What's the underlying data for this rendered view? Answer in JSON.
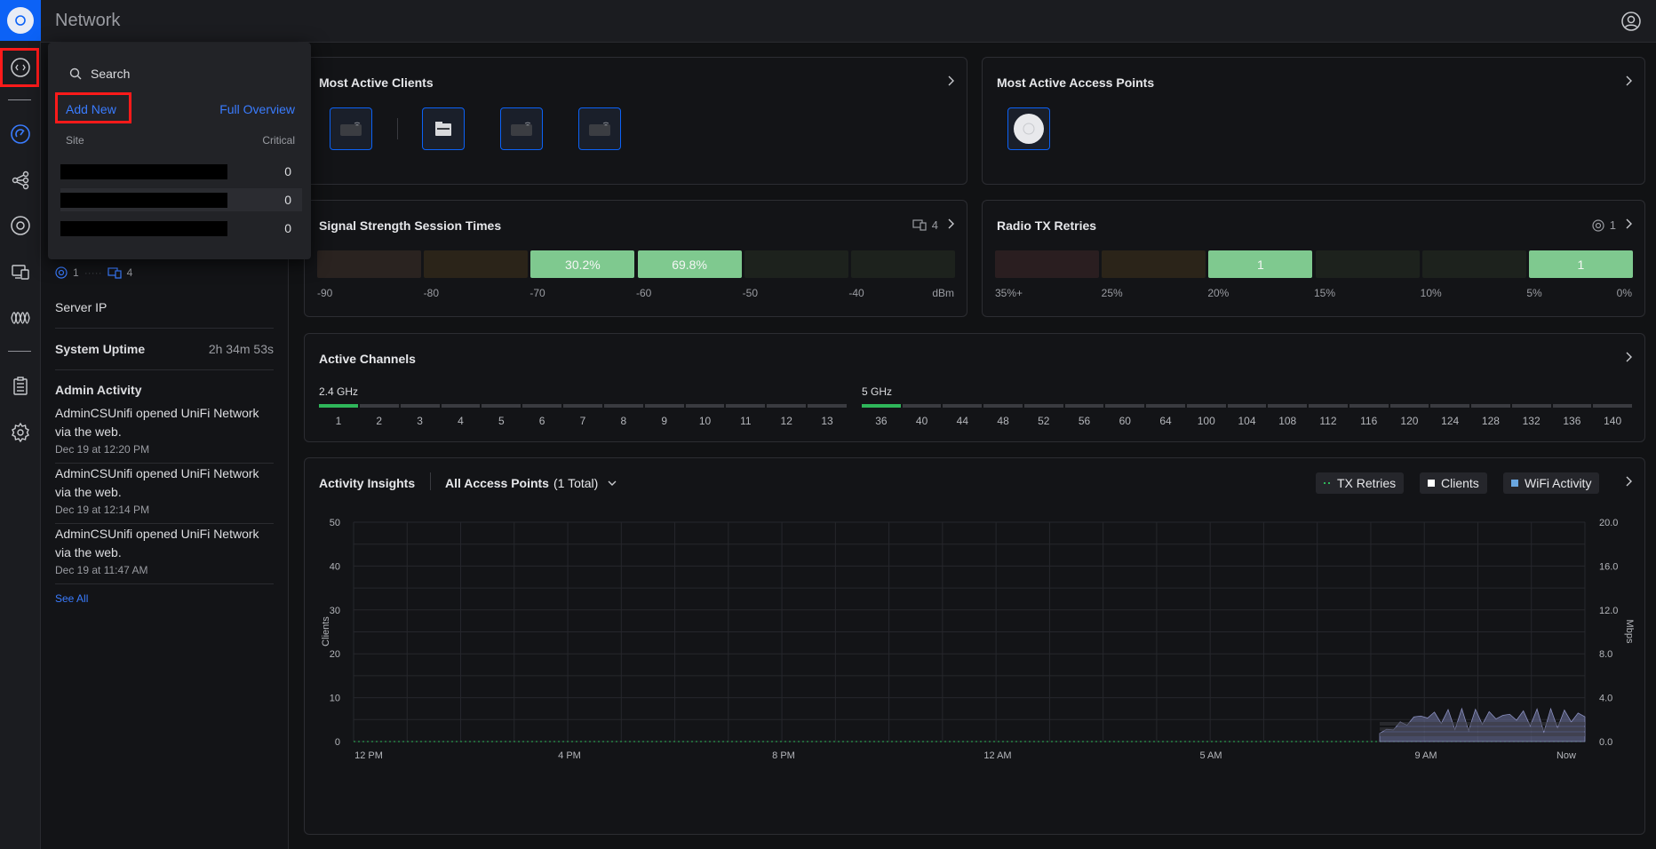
{
  "app": {
    "title": "Network"
  },
  "popover": {
    "search_placeholder": "Search",
    "add_new": "Add New",
    "full_overview": "Full Overview",
    "col_site": "Site",
    "col_critical": "Critical",
    "rows": [
      {
        "critical": "0"
      },
      {
        "critical": "0"
      },
      {
        "critical": "0"
      }
    ]
  },
  "left_panel": {
    "device_count": "1",
    "client_count": "4",
    "server_ip_label": "Server IP",
    "uptime_label": "System Uptime",
    "uptime_value": "2h 34m 53s",
    "admin_activity_label": "Admin Activity",
    "activity": [
      {
        "text": "AdminCSUnifi opened UniFi Network via the web.",
        "time": "Dec 19 at 12:20 PM"
      },
      {
        "text": "AdminCSUnifi opened UniFi Network via the web.",
        "time": "Dec 19 at 12:14 PM"
      },
      {
        "text": "AdminCSUnifi opened UniFi Network via the web.",
        "time": "Dec 19 at 11:47 AM"
      }
    ],
    "see_all": "See All"
  },
  "cards": {
    "most_active_clients": {
      "title": "Most Active Clients"
    },
    "most_active_aps": {
      "title": "Most Active Access Points"
    },
    "signal_strength": {
      "title": "Signal Strength Session Times",
      "count": "4",
      "segments": [
        {
          "label": "",
          "color": "#2a2320"
        },
        {
          "label": "",
          "color": "#2b2419"
        },
        {
          "label": "30.2%",
          "color": "#7fc98f"
        },
        {
          "label": "69.8%",
          "color": "#7fc98f"
        },
        {
          "label": "",
          "color": "#1d221d"
        },
        {
          "label": "",
          "color": "#1d221d"
        }
      ],
      "ticks": [
        "-90",
        "-80",
        "-70",
        "-60",
        "-50",
        "-40",
        "dBm"
      ]
    },
    "radio_tx": {
      "title": "Radio TX Retries",
      "count": "1",
      "segments": [
        {
          "label": "",
          "color": "#2a1e20"
        },
        {
          "label": "",
          "color": "#2b2419"
        },
        {
          "label": "1",
          "color": "#7fc98f"
        },
        {
          "label": "",
          "color": "#1d221d"
        },
        {
          "label": "",
          "color": "#1d221d"
        },
        {
          "label": "1",
          "color": "#7fc98f"
        }
      ],
      "ticks": [
        "35%+",
        "25%",
        "20%",
        "15%",
        "10%",
        "5%",
        "0%"
      ]
    },
    "active_channels": {
      "title": "Active Channels",
      "band_24": "2.4 GHz",
      "band_5": "5 GHz",
      "channels_24": [
        "1",
        "2",
        "3",
        "4",
        "5",
        "6",
        "7",
        "8",
        "9",
        "10",
        "11",
        "12",
        "13"
      ],
      "active_24": [
        "1"
      ],
      "channels_5": [
        "36",
        "40",
        "44",
        "48",
        "52",
        "56",
        "60",
        "64",
        "100",
        "104",
        "108",
        "112",
        "116",
        "120",
        "124",
        "128",
        "132",
        "136",
        "140"
      ],
      "active_5": [
        "36"
      ]
    },
    "activity_insights": {
      "title": "Activity Insights",
      "filter_label": "All Access Points",
      "filter_count": "(1 Total)",
      "legend": [
        {
          "name": "TX Retries",
          "color": "#2fb65a"
        },
        {
          "name": "Clients",
          "color": "#ffffff"
        },
        {
          "name": "WiFi Activity",
          "color": "#6aa7e0"
        }
      ]
    }
  },
  "chart_data": {
    "type": "line",
    "x": [
      "12 PM",
      "4 PM",
      "8 PM",
      "12 AM",
      "5 AM",
      "9 AM",
      "Now"
    ],
    "ylabel": "Clients",
    "ylim": [
      0,
      50
    ],
    "yticks": [
      "50",
      "40",
      "30",
      "20",
      "10",
      "0"
    ],
    "y2label": "Mbps",
    "y2lim": [
      0,
      20
    ],
    "y2ticks": [
      "20.0",
      "16.0",
      "12.0",
      "8.0",
      "4.0",
      "0.0"
    ],
    "grid": true,
    "series": [
      {
        "name": "TX Retries",
        "values": [
          0,
          0,
          0,
          0,
          0,
          0,
          0
        ]
      },
      {
        "name": "Clients",
        "values": [
          0,
          0,
          0,
          0,
          0,
          0,
          0
        ]
      },
      {
        "name": "WiFi Activity",
        "values": [
          0,
          0,
          0,
          0,
          0,
          0.6,
          0.4
        ]
      }
    ]
  }
}
